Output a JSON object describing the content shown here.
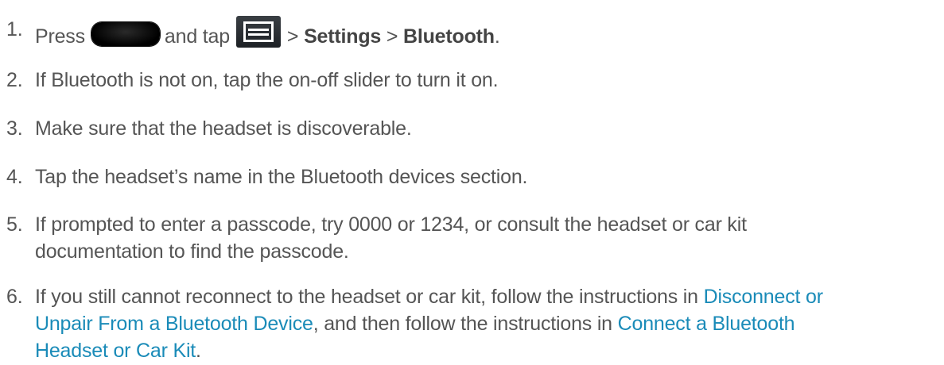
{
  "steps": [
    {
      "num": "1.",
      "press": "Press",
      "home_key_icon": "home-key-icon",
      "and_tap": "and tap",
      "menu_key_icon": "menu-key-icon",
      "sep1": ">",
      "settings": "Settings",
      "sep2": ">",
      "bluetooth": "Bluetooth",
      "end": "."
    },
    {
      "num": "2.",
      "text": "If Bluetooth is not on, tap the on-off slider to turn it on."
    },
    {
      "num": "3.",
      "text": "Make sure that the headset is discoverable."
    },
    {
      "num": "4.",
      "text": "Tap the headset’s name in the Bluetooth devices section."
    },
    {
      "num": "5.",
      "line1": "If prompted to enter a passcode, try 0000 or 1234, or consult the headset or car kit",
      "line2": "documentation to find the passcode."
    },
    {
      "num": "6.",
      "pre": "If you still cannot reconnect to the headset or car kit, follow the instructions in",
      "link1_part1": "Disconnect or",
      "link1_part2": "Unpair From a Bluetooth Device",
      "mid": ", and then follow the instructions in",
      "link2_part1": "Connect a Bluetooth",
      "link2_part2": "Headset or Car Kit",
      "end": "."
    }
  ],
  "colors": {
    "text": "#555555",
    "link": "#1a8bb8",
    "bold": "#444444"
  }
}
